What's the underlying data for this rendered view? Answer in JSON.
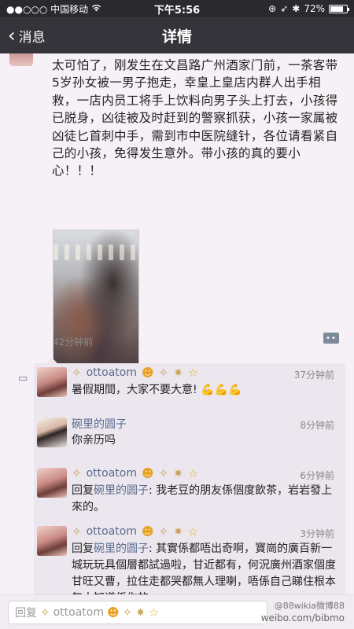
{
  "status_bar": {
    "carrier": "●●○○○ 中国移动",
    "wifi_icon": "wifi-icon",
    "time": "下午5:56",
    "battery": "72%",
    "battery_level": 0.72
  },
  "nav": {
    "back_label": "消息",
    "title": "详情"
  },
  "post": {
    "text": "太可怕了，刚发生在文昌路广州酒家门前，一茶客带5岁孙女被一男子抱走，幸皇上皇店内群人出手相救，一店内员工将手上饮料向男子头上打去，小孩得已脱身，凶徒被及时赶到的警察抓获，小孩一家属被凶徒匕首刺中手，需到市中医院缝针，各位请看紧自己的小孩，免得发生意外。带小孩的真的要小心！！！",
    "time": "42分钟前",
    "more_label": "••"
  },
  "comments": [
    {
      "name": "ottoatom",
      "time": "37分钟前",
      "text": "暑假期間，大家不要大意!",
      "emoji": "💪💪💪",
      "decorated": true
    },
    {
      "name": "碗里的圆子",
      "time": "8分钟前",
      "text": "你亲历吗",
      "decorated": false
    },
    {
      "name": "ottoatom",
      "time": "6分钟前",
      "reply_label": "回复",
      "reply_to": "碗里的圆子",
      "text": ": 我老豆的朋友係個度飲茶，岩岩發上來的。",
      "decorated": true
    },
    {
      "name": "ottoatom",
      "time": "3分钟前",
      "reply_label": "回复",
      "reply_to": "碗里的圆子",
      "text": ": 其實係都唔出奇啊，寶崗的廣百新一城玩玩具個層都試過啦，甘近都有，何況廣州酒家個度甘旺又曹，拉住走都哭都無人理喇，唔係自己睇住根本無人知道係你的。",
      "decorated": true
    }
  ],
  "input": {
    "placeholder_prefix": "回复",
    "placeholder_name": "ottoatom"
  },
  "watermark": {
    "line1": "@88wikia微博88",
    "line2": "weibo.com/bibmo"
  }
}
